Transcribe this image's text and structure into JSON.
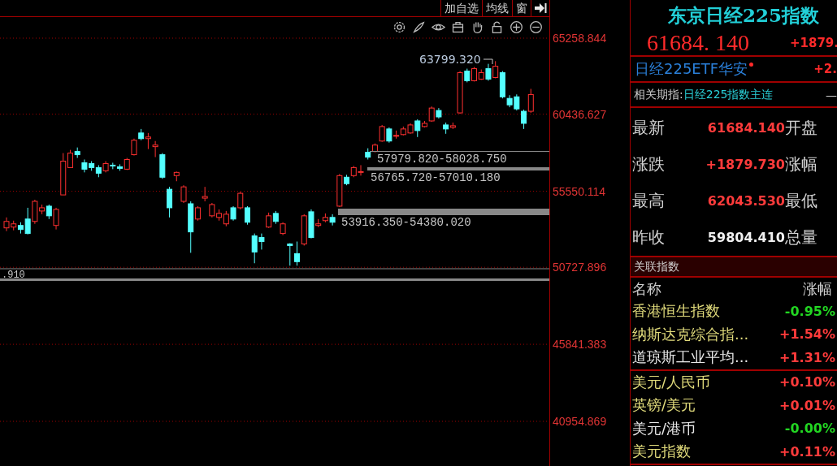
{
  "toolbar": {
    "buttons": [
      "加自选",
      "均线",
      "窗"
    ]
  },
  "chart": {
    "high_marker": "63799.320",
    "levels": [
      {
        "label": "57979.820-58028.750"
      },
      {
        "label": "56765.720-57010.180"
      },
      {
        "label": "53916.350-54380.020"
      },
      {
        "label": ".910"
      }
    ],
    "chart_data": {
      "type": "candlestick",
      "grid": true,
      "ylim": [
        38123,
        67679
      ],
      "yticks": [
        65258.844,
        60436.627,
        55550.114,
        50727.896,
        45841.383,
        40954.869
      ],
      "ohlc": [
        [
          53226,
          53889,
          53022,
          53634
        ],
        [
          53277,
          53685,
          53073,
          53481
        ],
        [
          53379,
          53583,
          52869,
          53124
        ],
        [
          53787,
          54501,
          52818,
          52869
        ],
        [
          53634,
          55011,
          53481,
          54909
        ],
        [
          54297,
          54705,
          54093,
          54501
        ],
        [
          54603,
          54705,
          53787,
          53991
        ],
        [
          53379,
          54501,
          53124,
          54399
        ],
        [
          55317,
          57969,
          55317,
          57459
        ],
        [
          57051,
          58173,
          57051,
          57969
        ],
        [
          58071,
          58326,
          57663,
          57867
        ],
        [
          57357,
          57561,
          56745,
          56949
        ],
        [
          57306,
          57459,
          56847,
          57051
        ],
        [
          57051,
          57204,
          56439,
          56694
        ],
        [
          56847,
          57459,
          56745,
          57306
        ],
        [
          57204,
          57357,
          56949,
          57153
        ],
        [
          57102,
          57255,
          56847,
          57000
        ],
        [
          56949,
          57663,
          56898,
          57561
        ],
        [
          57867,
          58887,
          57816,
          58785
        ],
        [
          59244,
          59499,
          58785,
          58887
        ],
        [
          58887,
          59244,
          58224,
          58989
        ],
        [
          58377,
          58734,
          57714,
          58479
        ],
        [
          57867,
          57969,
          56337,
          56439
        ],
        [
          55674,
          55827,
          53889,
          54501
        ],
        [
          56541,
          56796,
          56184,
          56745
        ],
        [
          54909,
          55929,
          54807,
          55827
        ],
        [
          54756,
          54909,
          51645,
          52971
        ],
        [
          53787,
          54603,
          53685,
          54501
        ],
        [
          55113,
          55827,
          54909,
          55215
        ],
        [
          53991,
          54807,
          53889,
          54705
        ],
        [
          53889,
          54399,
          53685,
          54144
        ],
        [
          53481,
          54297,
          53328,
          54093
        ],
        [
          54501,
          54603,
          53685,
          53787
        ],
        [
          54501,
          55521,
          54399,
          55419
        ],
        [
          54501,
          54603,
          53430,
          53583
        ],
        [
          52716,
          52869,
          50982,
          51696
        ],
        [
          52614,
          52869,
          51849,
          52359
        ],
        [
          53277,
          54195,
          53226,
          53991
        ],
        [
          54144,
          54297,
          53481,
          53634
        ],
        [
          52869,
          53583,
          52767,
          53481
        ],
        [
          52206,
          52257,
          50829,
          52104
        ],
        [
          51594,
          52359,
          50829,
          51084
        ],
        [
          52206,
          54093,
          52104,
          53991
        ],
        [
          54246,
          54399,
          52563,
          52614
        ],
        [
          53379,
          53787,
          53277,
          53481
        ],
        [
          53685,
          54144,
          53583,
          53889
        ],
        [
          53889,
          54093,
          53379,
          53583
        ],
        [
          54603,
          56643,
          54552,
          56541
        ],
        [
          56439,
          56592,
          55929,
          56031
        ],
        [
          56541,
          57153,
          56439,
          57051
        ],
        [
          56745,
          57204,
          56541,
          56796
        ],
        [
          58020,
          58275,
          57561,
          57714
        ],
        [
          58071,
          58581,
          58020,
          58479
        ],
        [
          58734,
          59754,
          58683,
          59652
        ],
        [
          59499,
          59601,
          58632,
          58734
        ],
        [
          59040,
          59397,
          58887,
          59091
        ],
        [
          59142,
          59652,
          59091,
          59499
        ],
        [
          59244,
          59856,
          59193,
          59754
        ],
        [
          60009,
          60111,
          58989,
          59397
        ],
        [
          59652,
          60009,
          59601,
          59856
        ],
        [
          60009,
          60927,
          59958,
          60825
        ],
        [
          60672,
          60825,
          60162,
          60264
        ],
        [
          59754,
          59907,
          59193,
          59499
        ],
        [
          59601,
          59907,
          59499,
          59703
        ],
        [
          60519,
          63171,
          60468,
          63069
        ],
        [
          63171,
          63324,
          62457,
          62559
        ],
        [
          62559,
          63426,
          62508,
          63324
        ],
        [
          62661,
          63273,
          62610,
          63069
        ],
        [
          63324,
          63630,
          62559,
          62661
        ],
        [
          62763,
          63799,
          62712,
          63477
        ],
        [
          63069,
          63171,
          61437,
          61539
        ],
        [
          61437,
          61641,
          60876,
          61029
        ],
        [
          61539,
          61692,
          60672,
          60774
        ],
        [
          60621,
          60723,
          59499,
          59856
        ],
        [
          60621,
          62043,
          60519,
          61684
        ]
      ]
    }
  },
  "quote": {
    "title": "东京日经225指数",
    "price": "61684. 140",
    "change": "+1879."
  },
  "etf": {
    "name": "日经225ETF华安",
    "change": "+2.",
    "alert": true
  },
  "futures": {
    "label": "相关期指:",
    "name": "日经225指数主连",
    "value": "—"
  },
  "stats": [
    {
      "label": "最新",
      "value": "61684.140",
      "color": "#ff3b3b",
      "label2": "开盘"
    },
    {
      "label": "涨跌",
      "value": "+1879.730",
      "color": "#ff3b3b",
      "label2": "涨幅"
    },
    {
      "label": "最高",
      "value": "62043.530",
      "color": "#ff3b3b",
      "label2": "最低"
    },
    {
      "label": "昨收",
      "value": "59804.410",
      "color": "#f0f0f0",
      "label2": "总量"
    }
  ],
  "related": {
    "title": "关联指数",
    "columns": [
      "名称",
      "涨幅"
    ],
    "groups": [
      [
        {
          "name": "香港恒生指数",
          "color": "#e2dc7c",
          "change": {
            "text": "-0.95%",
            "color": "#22d622"
          }
        },
        {
          "name": "纳斯达克综合指...",
          "color": "#e2dc7c",
          "change": {
            "text": "+1.54%",
            "color": "#ff3b3b"
          }
        },
        {
          "name": "道琼斯工业平均...",
          "color": "#e8e8e8",
          "change": {
            "text": "+1.31%",
            "color": "#ff3b3b"
          }
        }
      ],
      [
        {
          "name": "美元/人民币",
          "color": "#e2dc7c",
          "change": {
            "text": "+0.10%",
            "color": "#ff3b3b"
          }
        },
        {
          "name": "英镑/美元",
          "color": "#e2dc7c",
          "change": {
            "text": "+0.01%",
            "color": "#ff3b3b"
          }
        },
        {
          "name": "美元/港币",
          "color": "#e8e8e8",
          "change": {
            "text": "-0.00%",
            "color": "#22d622"
          }
        },
        {
          "name": "美元指数",
          "color": "#e2dc7c",
          "change": {
            "text": "+0.11%",
            "color": "#ff3b3b"
          }
        }
      ]
    ]
  }
}
